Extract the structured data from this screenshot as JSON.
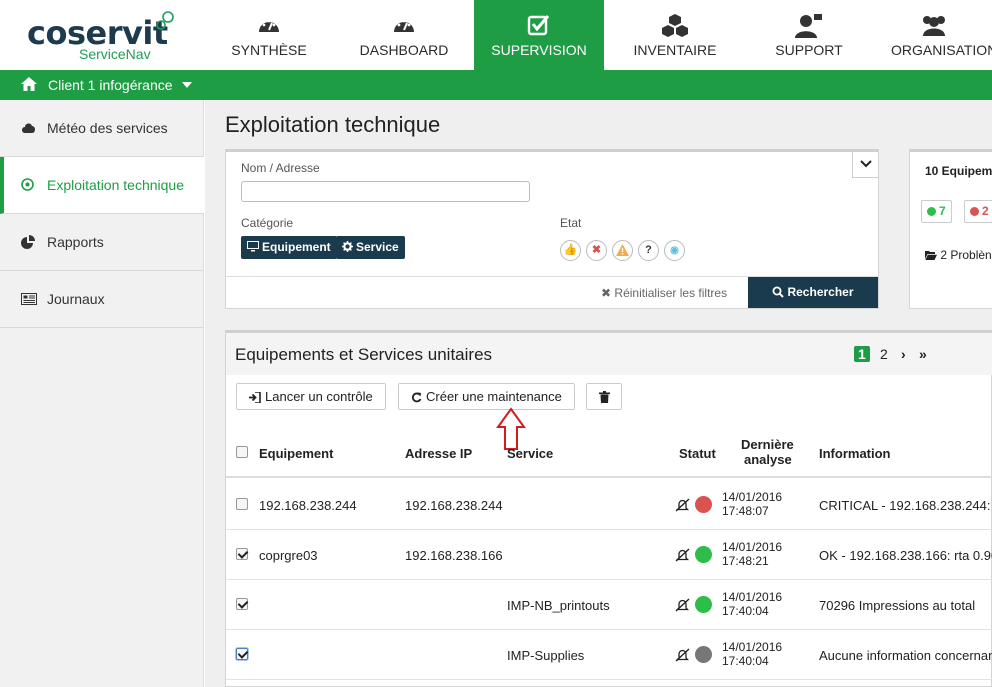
{
  "brand": {
    "name": "coservit",
    "sub": "ServiceNav"
  },
  "nav": [
    {
      "label": "SYNTHÈSE",
      "icon": "gauge-icon",
      "active": false
    },
    {
      "label": "DASHBOARD",
      "icon": "gauge-icon",
      "active": false
    },
    {
      "label": "SUPERVISION",
      "icon": "check-square-icon",
      "active": true
    },
    {
      "label": "INVENTAIRE",
      "icon": "cubes-icon",
      "active": false
    },
    {
      "label": "SUPPORT",
      "icon": "user-support-icon",
      "active": false
    },
    {
      "label": "ORGANISATION",
      "icon": "users-icon",
      "active": false
    }
  ],
  "client": {
    "label": "Client 1 infogérance"
  },
  "sidebar": [
    {
      "label": "Météo des services",
      "icon": "cloud-icon",
      "active": false
    },
    {
      "label": "Exploitation technique",
      "icon": "target-icon",
      "active": true
    },
    {
      "label": "Rapports",
      "icon": "pie-chart-icon",
      "active": false
    },
    {
      "label": "Journaux",
      "icon": "newspaper-icon",
      "active": false
    }
  ],
  "page": {
    "title": "Exploitation technique"
  },
  "filters": {
    "name_label": "Nom / Adresse",
    "name_value": "",
    "category_label": "Catégorie",
    "cat_equipment": "Equipement",
    "cat_service": "Service",
    "state_label": "Etat",
    "state_ok": "👍",
    "state_critical": "✖",
    "state_warning": "!",
    "state_unknown": "?",
    "state_hidden": "◉",
    "reset_label": "Réinitialiser les filtres",
    "search_label": "Rechercher"
  },
  "summary": {
    "title": "10 Equipem",
    "count_green": "7",
    "count_red": "2",
    "problems": "2 Problèn",
    "colors": {
      "green": "#2dbe4a",
      "red": "#d9534f"
    }
  },
  "list": {
    "title": "Equipements et Services unitaires",
    "pages": {
      "current": "1",
      "next_page": "2",
      "next": "›",
      "last": "»"
    },
    "btn_control": "Lancer un contrôle",
    "btn_maintenance": "Créer une maintenance",
    "columns": {
      "equipment": "Equipement",
      "ip": "Adresse IP",
      "service": "Service",
      "status": "Statut",
      "last_line1": "Dernière",
      "last_line2": "analyse",
      "info": "Information"
    },
    "rows": [
      {
        "checked": false,
        "equipment": "192.168.238.244",
        "ip": "192.168.238.244",
        "service": "",
        "status_color": "#d9534f",
        "date": "14/01/2016",
        "time": "17:48:07",
        "info": "CRITICAL - 192.168.238.244: r"
      },
      {
        "checked": true,
        "equipment": "coprgre03",
        "ip": "192.168.238.166",
        "service": "",
        "status_color": "#2dbe4a",
        "date": "14/01/2016",
        "time": "17:48:21",
        "info": "OK - 192.168.238.166: rta 0.90"
      },
      {
        "checked": true,
        "equipment": "",
        "ip": "",
        "service": "IMP-NB_printouts",
        "status_color": "#2dbe4a",
        "date": "14/01/2016",
        "time": "17:40:04",
        "info": "70296 Impressions au total"
      },
      {
        "checked": true,
        "equipment": "",
        "ip": "",
        "service": "IMP-Supplies",
        "status_color": "#777777",
        "date": "14/01/2016",
        "time": "17:40:04",
        "info": "Aucune information concernan"
      }
    ]
  }
}
